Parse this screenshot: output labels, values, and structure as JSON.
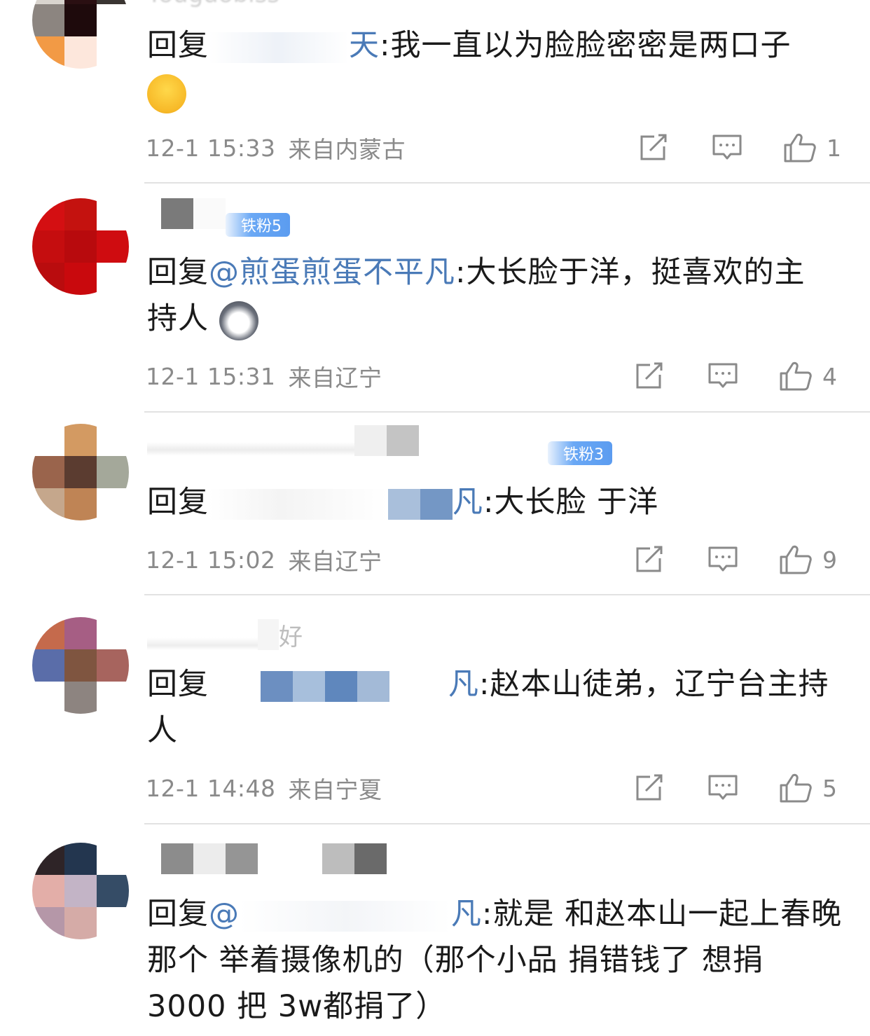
{
  "comments": [
    {
      "name": "Youguobiss",
      "reply_prefix": "回复",
      "mention": "天",
      "text_line1": ":我一直以为脸脸密密是两口子",
      "text_line2": "",
      "time": "12-1 15:33",
      "location": "来自内蒙古",
      "likes": "1",
      "emoji": "crying-face"
    },
    {
      "fan_badge": "铁粉5",
      "reply_prefix": "回复",
      "mention": "@煎蛋煎蛋不平凡",
      "text_line1": ":大长脸于洋，挺喜欢的主",
      "text_line2": "持人",
      "time": "12-1 15:31",
      "location": "来自辽宁",
      "likes": "4",
      "emoji": "husky-face"
    },
    {
      "fan_badge": "铁粉3",
      "reply_prefix": "回复",
      "mention": "凡",
      "text_line1": ":大长脸 于洋",
      "time": "12-1 15:02",
      "location": "来自辽宁",
      "likes": "9"
    },
    {
      "name": "好",
      "reply_prefix": "回复",
      "mention": "凡",
      "text_line1": ":赵本山徒弟，辽宁台主持",
      "text_line2": "人",
      "time": "12-1 14:48",
      "location": "来自宁夏",
      "likes": "5"
    },
    {
      "reply_prefix": "回复",
      "mention": "@",
      "mention_end": "凡",
      "text_line1": ":就是 和赵本山一起上春晚",
      "text_line2": "那个 举着摄像机的（那个小品 捐错钱了 想捐",
      "text_line3": "3000 把 3w都捐了）"
    }
  ],
  "icons": {
    "repost": "share-icon",
    "comment": "comment-icon",
    "like": "thumbs-up-icon"
  },
  "colors": {
    "mention": "#4a7ab7",
    "meta": "#8a8a8a",
    "divider": "#e2e2e2",
    "badge": "#5b9cf0"
  }
}
